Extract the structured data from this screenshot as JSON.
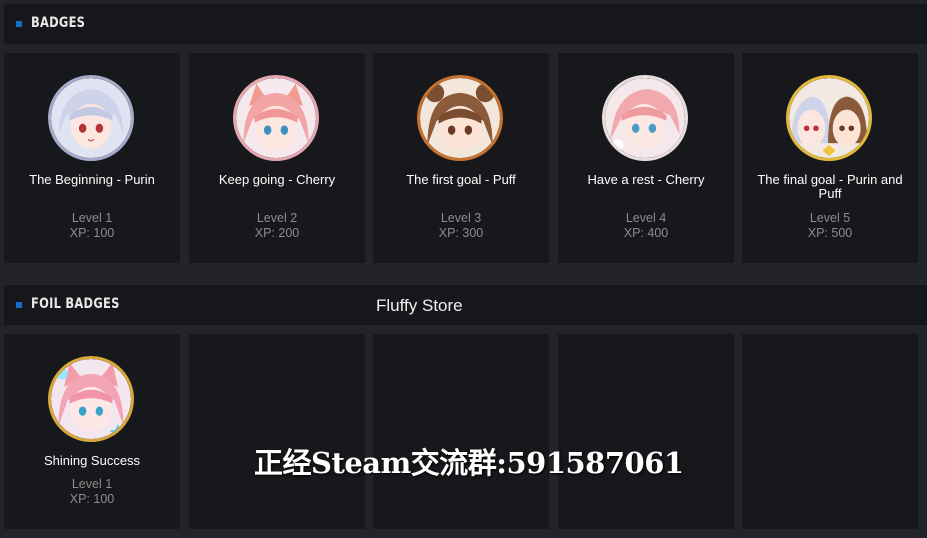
{
  "badges_section": {
    "title": "BADGES",
    "items": [
      {
        "name": "The Beginning - Purin",
        "level": "Level 1",
        "xp": "XP: 100",
        "hair": "#cfd3ea",
        "ring": "#a6aacb"
      },
      {
        "name": "Keep going - Cherry",
        "level": "Level 2",
        "xp": "XP: 200",
        "hair": "#f3a5a5",
        "ring": "#e6a7b1"
      },
      {
        "name": "The first goal - Puff",
        "level": "Level 3",
        "xp": "XP: 300",
        "hair": "#8a5a3a",
        "ring": "#c9722e"
      },
      {
        "name": "Have a rest - Cherry",
        "level": "Level 4",
        "xp": "XP: 400",
        "hair": "#f1a9ae",
        "ring": "#e9dede"
      },
      {
        "name": "The final goal - Purin and Puff",
        "level": "Level 5",
        "xp": "XP: 500",
        "hair": "#b8a090",
        "ring": "#e3b93a"
      }
    ]
  },
  "foil_section": {
    "title": "FOIL BADGES",
    "store_label": "Fluffy Store",
    "items": [
      {
        "name": "Shining Success",
        "level": "Level 1",
        "xp": "XP: 100",
        "hair": "#f3a5b5",
        "ring": "#d9a83a"
      }
    ]
  },
  "watermark": "正经Steam交流群:591587061"
}
